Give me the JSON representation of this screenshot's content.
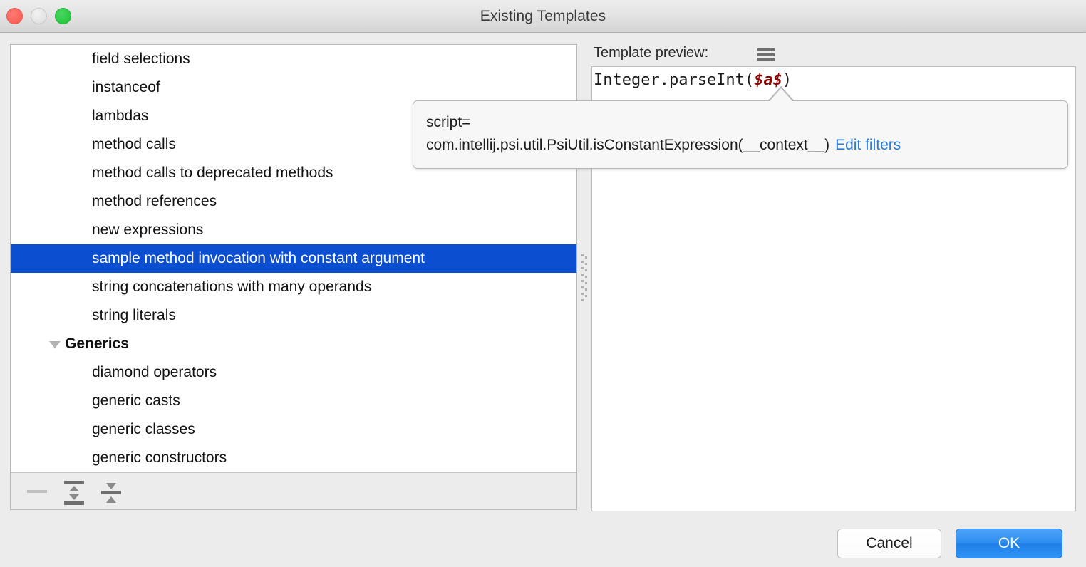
{
  "window": {
    "title": "Existing Templates",
    "traffic_lights": [
      {
        "name": "close",
        "color": "#fb6058"
      },
      {
        "name": "minimize",
        "color": "#e2e2e2"
      },
      {
        "name": "maximize",
        "color": "#28c940"
      }
    ]
  },
  "list": {
    "items": [
      {
        "label": "field selections",
        "type": "item",
        "selected": false
      },
      {
        "label": "instanceof",
        "type": "item",
        "selected": false
      },
      {
        "label": "lambdas",
        "type": "item",
        "selected": false
      },
      {
        "label": "method calls",
        "type": "item",
        "selected": false
      },
      {
        "label": "method calls to deprecated methods",
        "type": "item",
        "selected": false
      },
      {
        "label": "method references",
        "type": "item",
        "selected": false
      },
      {
        "label": "new expressions",
        "type": "item",
        "selected": false
      },
      {
        "label": "sample method invocation with constant argument",
        "type": "item",
        "selected": true
      },
      {
        "label": "string concatenations with many operands",
        "type": "item",
        "selected": false
      },
      {
        "label": "string literals",
        "type": "item",
        "selected": false
      },
      {
        "label": "Generics",
        "type": "group",
        "expanded": true,
        "selected": false
      },
      {
        "label": "diamond operators",
        "type": "item",
        "selected": false
      },
      {
        "label": "generic casts",
        "type": "item",
        "selected": false
      },
      {
        "label": "generic classes",
        "type": "item",
        "selected": false
      },
      {
        "label": "generic constructors",
        "type": "item",
        "selected": false
      }
    ],
    "selection_color": "#0b4ed0",
    "toolbar": [
      {
        "name": "remove-template-button",
        "icon": "minus-icon",
        "enabled": false
      },
      {
        "name": "expand-all-button",
        "icon": "expand-all-icon",
        "enabled": true
      },
      {
        "name": "collapse-all-button",
        "icon": "collapse-all-icon",
        "enabled": true
      }
    ]
  },
  "preview": {
    "label": "Template preview:",
    "menu_icon": "hamburger-icon",
    "code_prefix": "Integer.parseInt(",
    "code_variable": "$a$",
    "code_suffix": ")",
    "variable_color": "#8b0000"
  },
  "tooltip": {
    "line1": "script=",
    "line2": "com.intellij.psi.util.PsiUtil.isConstantExpression(__context__)",
    "link": "Edit filters",
    "link_color": "#2a7bd4"
  },
  "footer": {
    "cancel_label": "Cancel",
    "ok_label": "OK",
    "ok_color": "#2b8cf0"
  }
}
